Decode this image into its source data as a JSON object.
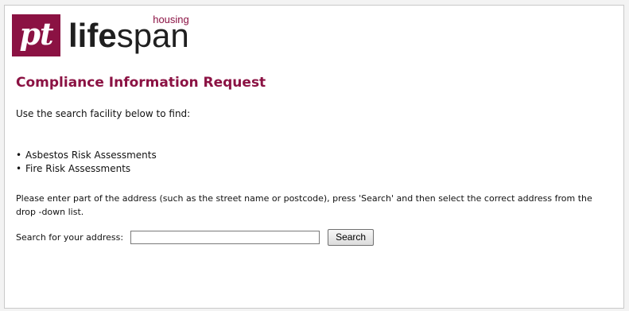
{
  "brand": {
    "mark": "pt",
    "name_bold": "life",
    "name_light": "span",
    "subtitle": "housing",
    "color": "#8b1243"
  },
  "page": {
    "title": "Compliance Information Request",
    "intro": "Use the search facility below to find:",
    "items": [
      {
        "label": "Asbestos Risk Assessments"
      },
      {
        "label": "Fire Risk Assessments"
      }
    ],
    "bullet": "•",
    "instructions": "Please enter part of the address (such as the street name or postcode), press 'Search' and then select the correct address from the drop -down list."
  },
  "search": {
    "label": "Search for your address:",
    "value": "",
    "button_label": "Search"
  }
}
